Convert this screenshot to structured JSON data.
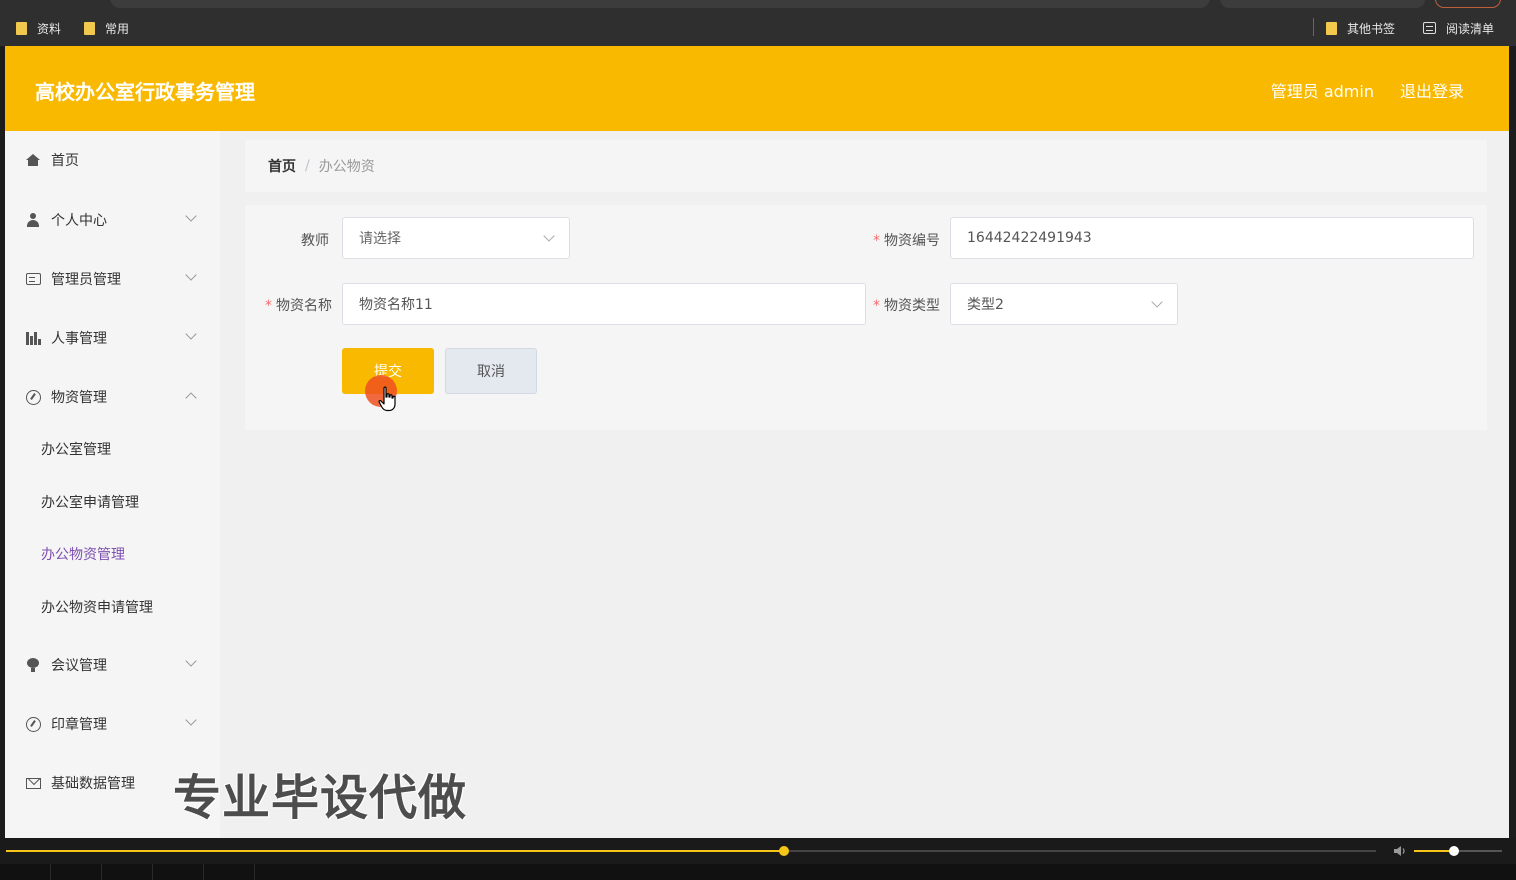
{
  "browser": {
    "bookmarks": [
      {
        "label": "资料"
      },
      {
        "label": "常用"
      }
    ],
    "bookmarks_right": [
      {
        "label": "其他书签"
      },
      {
        "label": "阅读清单"
      }
    ]
  },
  "header": {
    "title": "高校办公室行政事务管理",
    "user_label": "管理员 admin",
    "logout_label": "退出登录",
    "accent_color": "#f8b900"
  },
  "sidebar": {
    "items": [
      {
        "label": "首页",
        "icon": "home-icon",
        "expandable": false
      },
      {
        "label": "个人中心",
        "icon": "user-icon",
        "expandable": true
      },
      {
        "label": "管理员管理",
        "icon": "id-card-icon",
        "expandable": true
      },
      {
        "label": "人事管理",
        "icon": "bar-chart-icon",
        "expandable": true
      },
      {
        "label": "物资管理",
        "icon": "compass-icon",
        "expandable": true,
        "expanded": true
      },
      {
        "label": "会议管理",
        "icon": "bulb-icon",
        "expandable": true
      },
      {
        "label": "印章管理",
        "icon": "compass-icon",
        "expandable": true
      },
      {
        "label": "基础数据管理",
        "icon": "mail-icon",
        "expandable": false
      }
    ],
    "subitems": [
      {
        "label": "办公室管理"
      },
      {
        "label": "办公室申请管理"
      },
      {
        "label": "办公物资管理",
        "active": true
      },
      {
        "label": "办公物资申请管理"
      }
    ],
    "active_color": "#7d4fb0"
  },
  "breadcrumb": {
    "home": "首页",
    "separator": "/",
    "current": "办公物资"
  },
  "form": {
    "teacher": {
      "label": "教师",
      "placeholder": "请选择"
    },
    "material_no": {
      "label": "物资编号",
      "value": "16442422491943",
      "required": true
    },
    "material_name": {
      "label": "物资名称",
      "value": "物资名称11",
      "required": true
    },
    "material_type": {
      "label": "物资类型",
      "value": "类型2",
      "required": true
    },
    "submit_label": "提交",
    "cancel_label": "取消"
  },
  "watermark": "专业毕设代做",
  "player": {
    "progress": 0.568,
    "volume": 0.45
  }
}
